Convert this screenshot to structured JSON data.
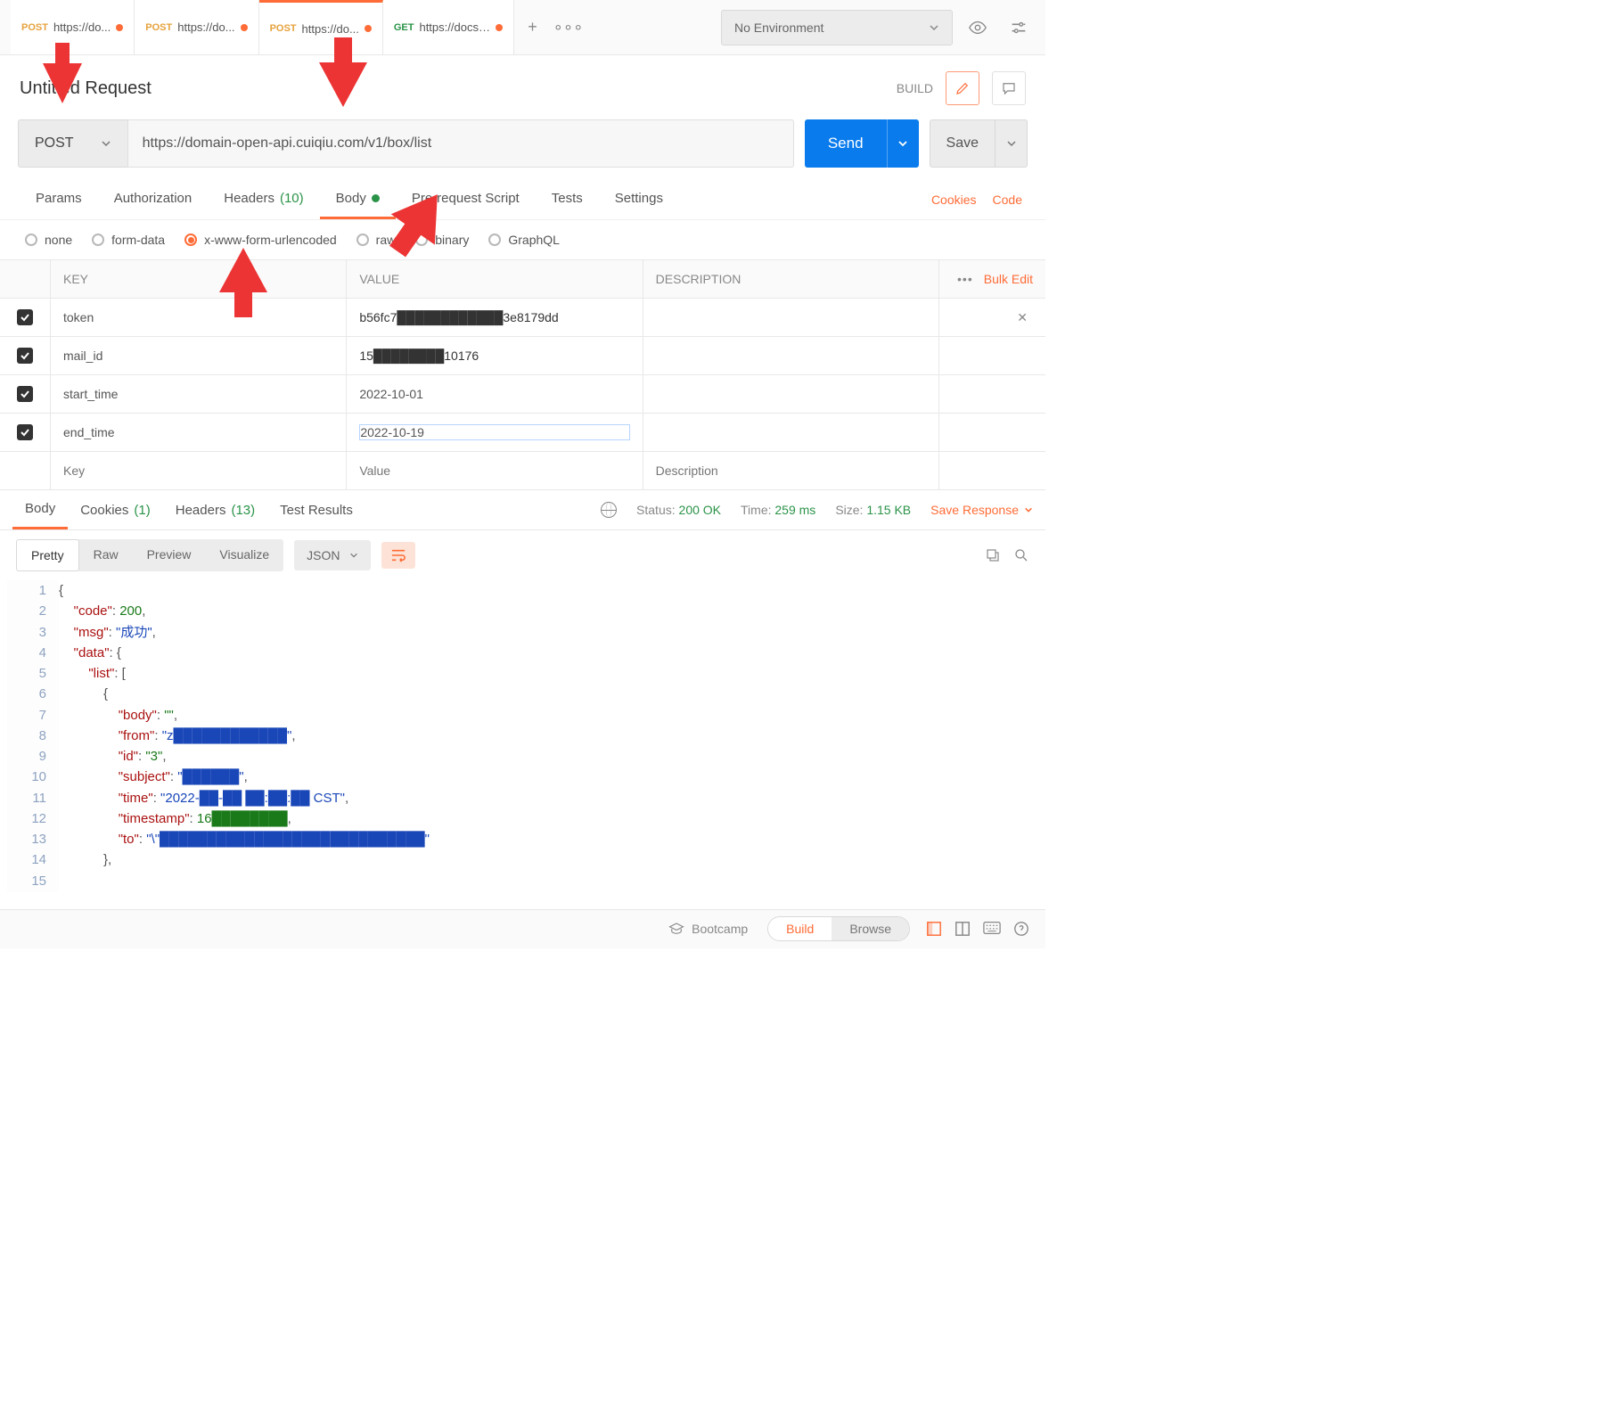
{
  "topTabs": [
    {
      "method": "POST",
      "label": "https://do...",
      "dirty": true,
      "methodClass": "method-post"
    },
    {
      "method": "POST",
      "label": "https://do...",
      "dirty": true,
      "methodClass": "method-post"
    },
    {
      "method": "POST",
      "label": "https://do...",
      "dirty": true,
      "methodClass": "method-post",
      "active": true
    },
    {
      "method": "GET",
      "label": "https://docs....",
      "dirty": true,
      "methodClass": "method-get"
    }
  ],
  "environment": {
    "label": "No Environment"
  },
  "request": {
    "name": "Untitled Request",
    "buildLabel": "BUILD",
    "method": "POST",
    "url": "https://domain-open-api.cuiqiu.com/v1/box/list",
    "sendLabel": "Send",
    "saveLabel": "Save"
  },
  "reqTabs": {
    "params": "Params",
    "auth": "Authorization",
    "headers": "Headers",
    "headersCount": "(10)",
    "body": "Body",
    "prereq": "Pre-request Script",
    "tests": "Tests",
    "settings": "Settings",
    "cookies": "Cookies",
    "code": "Code"
  },
  "bodyTypes": {
    "none": "none",
    "formData": "form-data",
    "xwww": "x-www-form-urlencoded",
    "raw": "raw",
    "binary": "binary",
    "graphql": "GraphQL"
  },
  "kvHeaders": {
    "key": "KEY",
    "value": "VALUE",
    "desc": "DESCRIPTION",
    "bulk": "Bulk Edit"
  },
  "kvRows": [
    {
      "key": "token",
      "value": "b56fc7████████████3e8179dd",
      "desc": ""
    },
    {
      "key": "mail_id",
      "value": "15████████10176",
      "desc": ""
    },
    {
      "key": "start_time",
      "value": "2022-10-01",
      "desc": ""
    },
    {
      "key": "end_time",
      "value": "2022-10-19",
      "desc": ""
    }
  ],
  "kvPlaceholders": {
    "key": "Key",
    "value": "Value",
    "desc": "Description"
  },
  "respTabs": {
    "body": "Body",
    "cookies": "Cookies",
    "cookiesCount": "(1)",
    "headers": "Headers",
    "headersCount": "(13)",
    "tests": "Test Results"
  },
  "respMeta": {
    "statusLabel": "Status:",
    "status": "200 OK",
    "timeLabel": "Time:",
    "time": "259 ms",
    "sizeLabel": "Size:",
    "size": "1.15 KB",
    "save": "Save Response"
  },
  "viewModes": {
    "pretty": "Pretty",
    "raw": "Raw",
    "preview": "Preview",
    "viz": "Visualize",
    "fmt": "JSON"
  },
  "json": {
    "code": "200",
    "msg": "\"成功\"",
    "bodyVal": "\"\"",
    "fromVal": "\"z████████████\"",
    "idVal": "\"3\"",
    "subjectVal": "\"██████\"",
    "timeVal": "\"2022-██-██ ██:██:██ CST\"",
    "timestampVal": "16████████",
    "toVal": "\"\\\"████████████████████████████\""
  },
  "statusBar": {
    "bootcamp": "Bootcamp",
    "build": "Build",
    "browse": "Browse"
  }
}
